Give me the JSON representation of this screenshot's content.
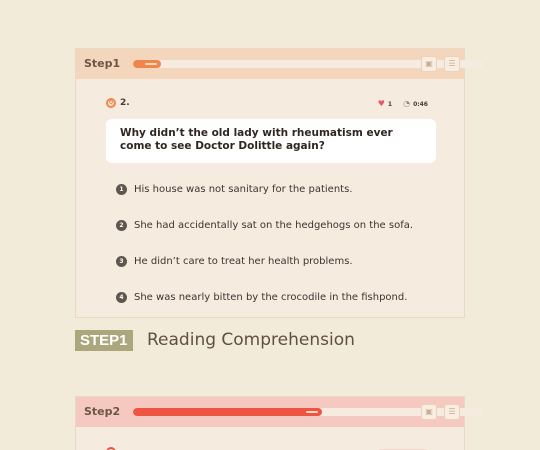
{
  "step1": {
    "label": "Step1",
    "progress": 0.08,
    "question": {
      "badge": "Q",
      "number": "2.",
      "lives": "1",
      "timer": "0:46",
      "text": "Why didn’t the old lady with rheumatism ever come to see Doctor Dolittle again?"
    },
    "options": [
      {
        "num": "1",
        "text": "His house was not sanitary for the patients."
      },
      {
        "num": "2",
        "text": "She had accidentally sat on the hedgehogs on the sofa."
      },
      {
        "num": "3",
        "text": "He didn’t care to treat her health problems."
      },
      {
        "num": "4",
        "text": "She was nearly bitten by the crocodile in the fishpond."
      }
    ]
  },
  "section_title": {
    "badge": "STEP1",
    "text": "Reading Comprehension"
  },
  "step2": {
    "label": "Step2",
    "progress": 0.54
  },
  "icons": {
    "expand": "expand-icon",
    "menu": "menu-icon",
    "heart": "heart-icon",
    "clock": "clock-icon"
  },
  "colors": {
    "step1_progress": "#f0874a",
    "step2_progress": "#ef5442",
    "section_badge": "#aba67b"
  }
}
